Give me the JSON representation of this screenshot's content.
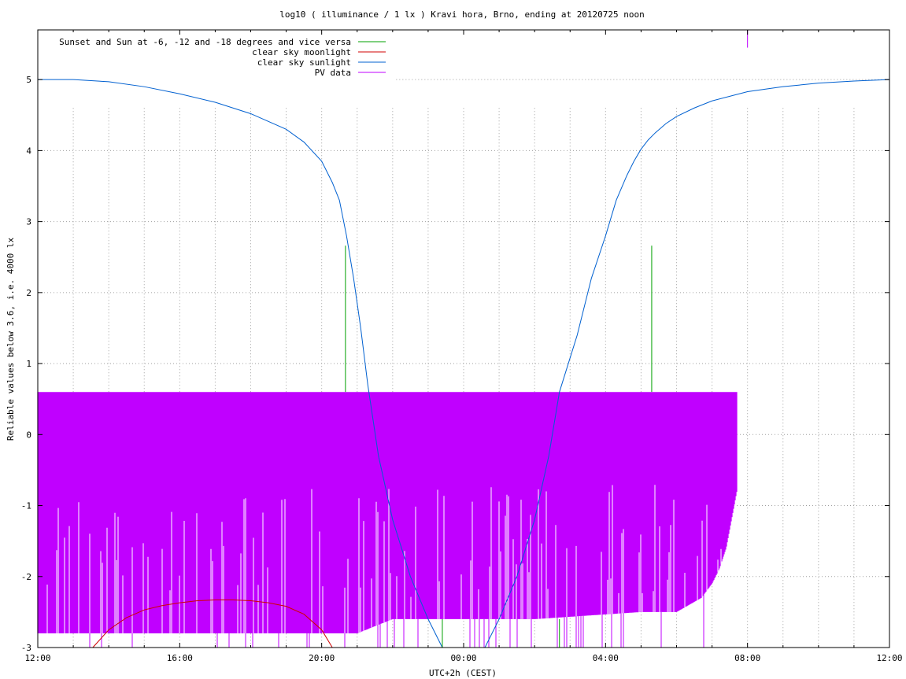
{
  "chart_data": {
    "type": "line",
    "title": "log10 ( illuminance / 1 lx ) Kravi hora, Brno, ending at 20120725 noon",
    "xlabel": "UTC+2h (CEST)",
    "ylabel": "Reliable values below 3.6, i.e. 4000 lx",
    "xlim": [
      12,
      36
    ],
    "ylim": [
      -3,
      5.7
    ],
    "x_tick_labels": [
      "12:00",
      "16:00",
      "20:00",
      "00:00",
      "04:00",
      "08:00",
      "12:00"
    ],
    "x_tick_values": [
      12,
      16,
      20,
      24,
      28,
      32,
      36
    ],
    "y_tick_labels": [
      "-3",
      "-2",
      "-1",
      "0",
      "1",
      "2",
      "3",
      "4",
      "5"
    ],
    "y_tick_values": [
      -3,
      -2,
      -1,
      0,
      1,
      2,
      3,
      4,
      5
    ],
    "grid": true,
    "legend_position": "top-left",
    "series": [
      {
        "name": "Sunset and Sun at -6, -12 and -18 degrees and vice versa",
        "color": "#00a000",
        "style": "impulses",
        "x": [
          20.67,
          23.4,
          26.7,
          29.3
        ],
        "y": [
          2.66,
          -3,
          -3,
          2.66
        ]
      },
      {
        "name": "clear sky moonlight",
        "color": "#d00000",
        "style": "line",
        "x": [
          13.55,
          14.0,
          14.5,
          15.0,
          15.5,
          16.0,
          16.5,
          17.0,
          17.5,
          18.0,
          18.5,
          19.0,
          19.5,
          20.0,
          20.3
        ],
        "y": [
          -3.0,
          -2.75,
          -2.58,
          -2.47,
          -2.41,
          -2.37,
          -2.34,
          -2.33,
          -2.33,
          -2.34,
          -2.37,
          -2.42,
          -2.53,
          -2.75,
          -3.0
        ]
      },
      {
        "name": "clear sky sunlight",
        "color": "#0060d0",
        "style": "line",
        "x": [
          12.0,
          13.0,
          14.0,
          15.0,
          16.0,
          17.0,
          18.0,
          19.0,
          19.5,
          20.0,
          20.3,
          20.5,
          20.7,
          20.9,
          21.1,
          21.3,
          21.6,
          22.0,
          22.5,
          23.0,
          23.4,
          24.6,
          25.0,
          25.5,
          26.0,
          26.4,
          26.7,
          27.2,
          27.6,
          28.0,
          28.3,
          28.6,
          28.8,
          29.0,
          29.2,
          29.4,
          29.7,
          30.0,
          30.5,
          31.0,
          32.0,
          33.0,
          34.0,
          35.0,
          36.0
        ],
        "y": [
          5.0,
          5.0,
          4.97,
          4.9,
          4.8,
          4.68,
          4.52,
          4.3,
          4.12,
          3.85,
          3.55,
          3.3,
          2.8,
          2.2,
          1.5,
          0.7,
          -0.3,
          -1.2,
          -2.0,
          -2.6,
          -3.0,
          -3.0,
          -2.6,
          -2.0,
          -1.2,
          -0.3,
          0.6,
          1.4,
          2.2,
          2.8,
          3.3,
          3.65,
          3.85,
          4.02,
          4.15,
          4.25,
          4.38,
          4.48,
          4.6,
          4.7,
          4.83,
          4.9,
          4.95,
          4.98,
          5.0
        ]
      },
      {
        "name": "PV data",
        "color": "#c000ff",
        "style": "impulses",
        "x_range": [
          12.0,
          31.7
        ],
        "upper": 0.6,
        "lower_envelope": {
          "x": [
            12.0,
            17.0,
            21.0,
            22.0,
            25.0,
            26.0,
            29.0,
            30.0,
            30.7,
            31.0,
            31.2,
            31.4,
            31.7
          ],
          "y": [
            -2.8,
            -2.8,
            -2.8,
            -2.6,
            -2.6,
            -2.6,
            -2.5,
            -2.5,
            -2.3,
            -2.1,
            -1.9,
            -1.6,
            -0.8
          ]
        },
        "spike_x": 32.0,
        "spike_y": [
          5.45,
          5.7
        ]
      }
    ]
  }
}
